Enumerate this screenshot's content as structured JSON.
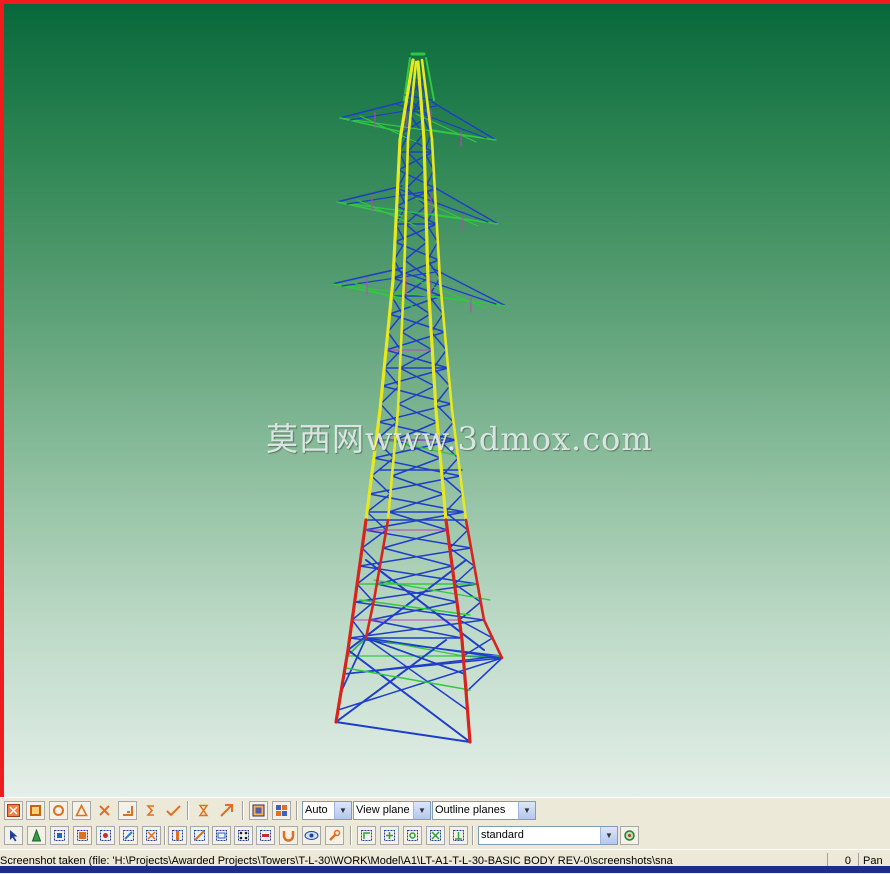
{
  "viewport": {
    "watermark": "莫西网www.3dmox.com",
    "model_description": "lattice transmission tower wireframe"
  },
  "toolbar1": {
    "buttons": [
      {
        "name": "select-all-button",
        "icon": "square-x-icon"
      },
      {
        "name": "rectangle-tool-button",
        "icon": "square-icon"
      },
      {
        "name": "circle-tool-button",
        "icon": "circle-icon"
      },
      {
        "name": "triangle-tool-button",
        "icon": "triangle-icon"
      },
      {
        "name": "delete-tool-button",
        "icon": "x-icon"
      },
      {
        "name": "dimension-tool-button",
        "icon": "corner-icon"
      },
      {
        "name": "snap-tool-button",
        "icon": "s-icon"
      },
      {
        "name": "check-tool-button",
        "icon": "check-icon"
      },
      {
        "name": "hourglass-tool-button",
        "icon": "hourglass-icon"
      },
      {
        "name": "arrow-tool-button",
        "icon": "diagonal-arrow-icon"
      },
      {
        "name": "render-mode-button",
        "icon": "cube-icon"
      },
      {
        "name": "grid-view-button",
        "icon": "grid-icon"
      }
    ],
    "combo_auto": "Auto",
    "combo_view_plane": "View plane",
    "combo_outline_planes": "Outline planes"
  },
  "toolbar2": {
    "combo_standard": "standard"
  },
  "statusbar": {
    "text": "Screenshot taken (file: 'H:\\Projects\\Awarded Projects\\Towers\\T-L-30\\WORK\\Model\\A1\\LT-A1-T-L-30-BASIC BODY REV-0\\screenshots\\sna",
    "count": "0",
    "mode": "Pan"
  },
  "colors": {
    "background_top": "#07673a",
    "background_bottom": "#e4efe9",
    "frame_red": "#ee1c1c",
    "leg_red": "#d8241c",
    "member_blue": "#1e3ec8",
    "member_yellow": "#e8e820",
    "member_green": "#30c840",
    "member_magenta": "#c040c0"
  }
}
